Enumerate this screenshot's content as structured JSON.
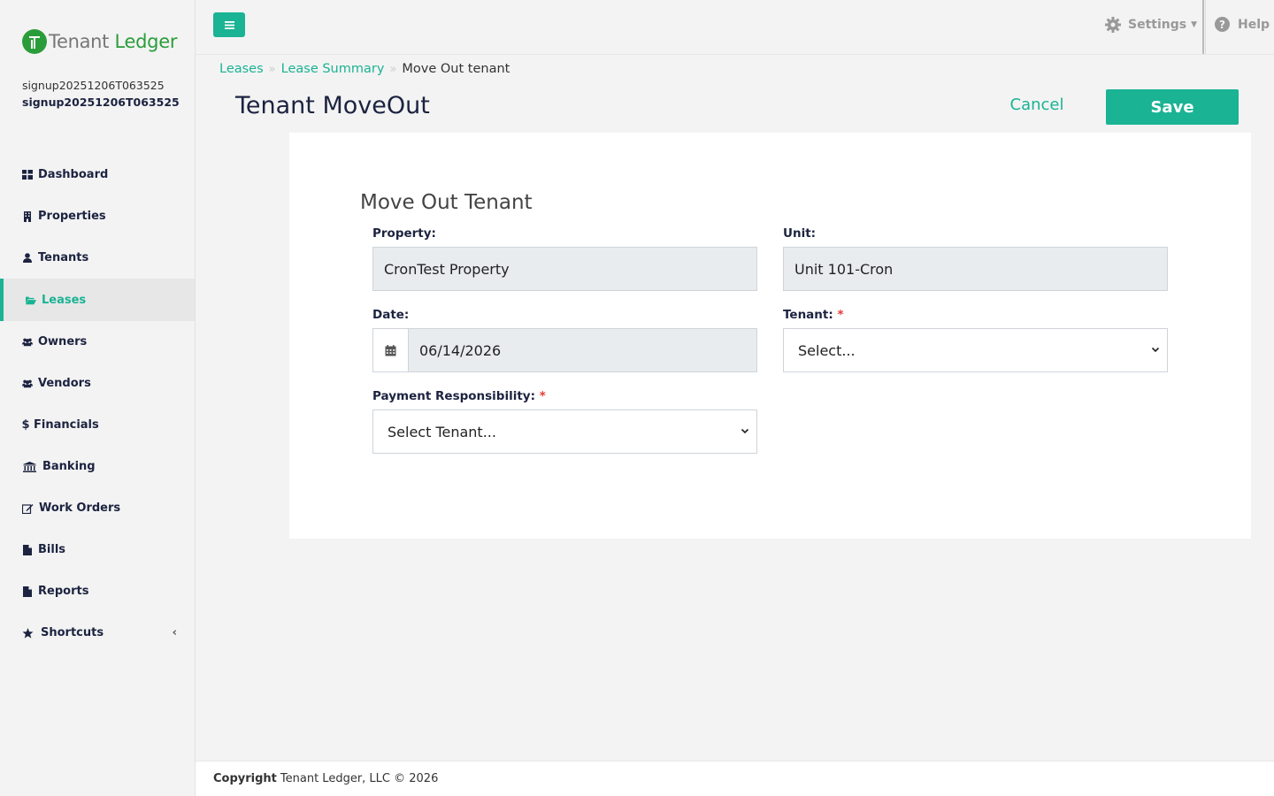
{
  "app": {
    "logo_part1": "Tenant",
    "logo_part2": "Ledger",
    "user_subtitle": "signup20251206T063525",
    "user_name": "signup20251206T063525",
    "accent_color": "#1ab394",
    "brand_green": "#2a9d3a"
  },
  "sidebar": {
    "items": [
      {
        "label": "Dashboard",
        "icon": "dashboard-icon"
      },
      {
        "label": "Properties",
        "icon": "building-icon"
      },
      {
        "label": "Tenants",
        "icon": "user-icon"
      },
      {
        "label": "Leases",
        "icon": "folder-open-icon",
        "active": true
      },
      {
        "label": "Owners",
        "icon": "users-icon"
      },
      {
        "label": "Vendors",
        "icon": "users-icon"
      },
      {
        "label": "Financials",
        "icon": "dollar-icon"
      },
      {
        "label": "Banking",
        "icon": "bank-icon"
      },
      {
        "label": "Work Orders",
        "icon": "edit-icon"
      },
      {
        "label": "Bills",
        "icon": "file-icon"
      },
      {
        "label": "Reports",
        "icon": "file-icon"
      },
      {
        "label": "Shortcuts",
        "icon": "star-icon"
      }
    ],
    "shortcuts_chevron": "‹"
  },
  "topbar": {
    "settings_label": "Settings",
    "help_label": "Help"
  },
  "breadcrumb": {
    "items": [
      "Leases",
      "Lease Summary"
    ],
    "current": "Move Out tenant"
  },
  "page": {
    "title": "Tenant MoveOut",
    "cancel_label": "Cancel",
    "save_label": "Save"
  },
  "form": {
    "title": "Move Out Tenant",
    "property_label": "Property:",
    "property_value": "CronTest Property",
    "unit_label": "Unit:",
    "unit_value": "Unit 101-Cron",
    "date_label": "Date:",
    "date_value": "06/14/2026",
    "tenant_label": "Tenant:",
    "tenant_value": "Select...",
    "payment_label": "Payment Responsibility:",
    "payment_value": "Select Tenant...",
    "required_mark": "*"
  },
  "footer": {
    "copyright_label": "Copyright",
    "copyright_text": "Tenant Ledger, LLC © 2026"
  }
}
